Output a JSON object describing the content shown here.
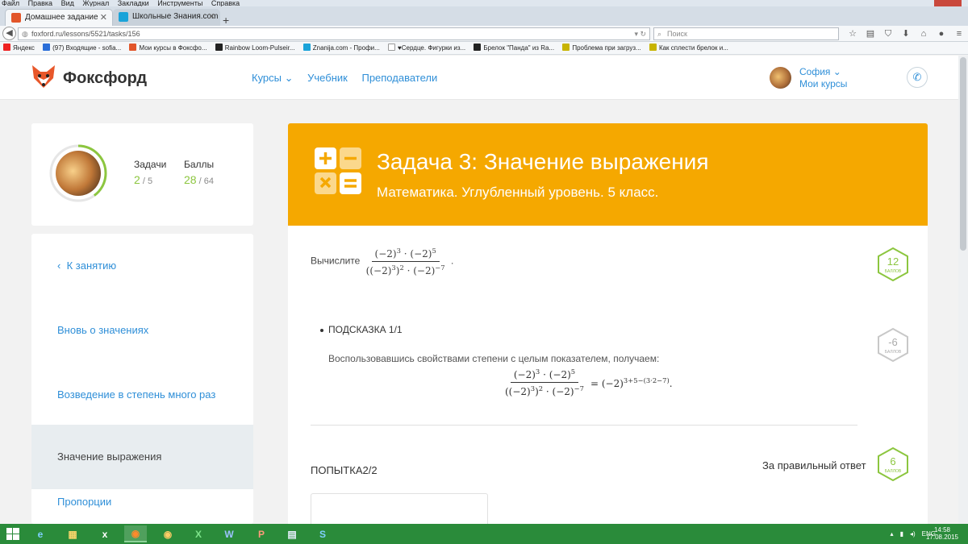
{
  "browser": {
    "menu": [
      "Файл",
      "Правка",
      "Вид",
      "Журнал",
      "Закладки",
      "Инструменты",
      "Справка"
    ],
    "tabs": [
      {
        "title": "Домашнее задание",
        "favicon_color": "#e2562a"
      },
      {
        "title": "Школьные Знания.com - ...",
        "favicon_color": "#1aa3d9"
      }
    ],
    "url": "foxford.ru/lessons/5521/tasks/156",
    "search_placeholder": "Поиск",
    "bookmarks": [
      {
        "label": "Яндекс",
        "color": "#e22"
      },
      {
        "label": "(97) Входящие - sofia...",
        "color": "#2a6ed8"
      },
      {
        "label": "Мои курсы в Фоксфо...",
        "color": "#e2562a"
      },
      {
        "label": "Rainbow Loom-Pulseir...",
        "color": "#222"
      },
      {
        "label": "Znanija.com - Профи...",
        "color": "#1aa3d9"
      },
      {
        "label": "♥Сердце. Фигурки из...",
        "color": "#ffffff"
      },
      {
        "label": "Брелок \"Панда\" из Ra...",
        "color": "#222"
      },
      {
        "label": "Проблема при загруз...",
        "color": "#c8b400"
      },
      {
        "label": "Как сплести брелок и...",
        "color": "#c8b400"
      }
    ]
  },
  "site": {
    "logo_text": "Фоксфорд",
    "nav": [
      "Курсы ⌄",
      "Учебник",
      "Преподаватели"
    ],
    "user": {
      "name": "София ⌄",
      "my_courses": "Мои курсы"
    }
  },
  "profile": {
    "tasks_label": "Задачи",
    "tasks_done": "2",
    "tasks_total": "5",
    "points_label": "Баллы",
    "points_done": "28",
    "points_total": "64",
    "progress_fraction": 0.4
  },
  "lessons": {
    "back": "К занятию",
    "items": [
      "Вновь о значениях",
      "Возведение в степень много раз",
      "Значение выражения",
      "Пропорции"
    ]
  },
  "task": {
    "title": "Задача 3: Значение выражения",
    "subtitle": "Математика. Углубленный уровень. 5 класс.",
    "prompt": "Вычислите",
    "points": "12",
    "points_unit": "БАЛЛОВ",
    "hint_label": "ПОДСКАЗКА 1/1",
    "hint_penalty": "-6",
    "hint_text": "Воспользовавшись свойствами степени с целым показателем, получаем:",
    "attempt_label": "ПОПЫТКА2/2",
    "correct_label": "За правильный ответ",
    "correct_points": "6"
  },
  "taskbar": {
    "apps": [
      "e",
      "▦",
      "x",
      "◉",
      "X",
      "W",
      "P",
      "▤",
      "S"
    ],
    "lang": "ENG",
    "time": "14:58",
    "date": "17.08.2015"
  }
}
